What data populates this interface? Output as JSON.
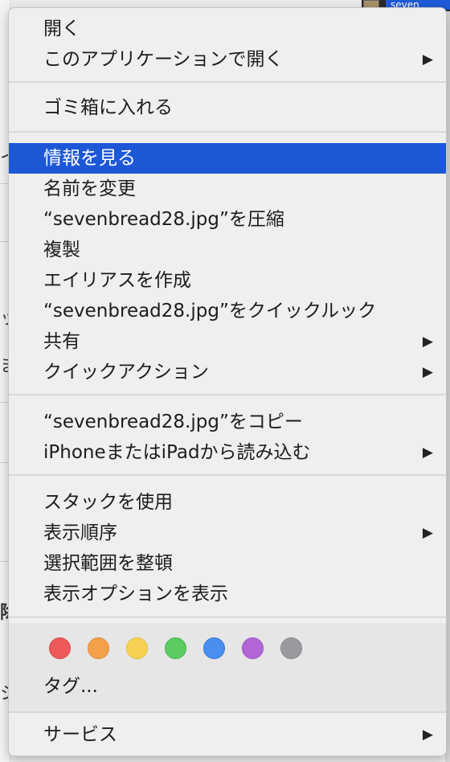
{
  "background": {
    "top_selected_text": "seven",
    "left_fragments": [
      "イ",
      "ッ",
      "ま",
      "除",
      "シ"
    ]
  },
  "menu": {
    "groups": [
      [
        {
          "label": "開く",
          "submenu": false
        },
        {
          "label": "このアプリケーションで開く",
          "submenu": true
        }
      ],
      [
        {
          "label": "ゴミ箱に入れる",
          "submenu": false
        }
      ],
      [
        {
          "label": "情報を見る",
          "submenu": false,
          "highlighted": true
        },
        {
          "label": "名前を変更",
          "submenu": false
        },
        {
          "label": "“sevenbread28.jpg”を圧縮",
          "submenu": false
        },
        {
          "label": "複製",
          "submenu": false
        },
        {
          "label": "エイリアスを作成",
          "submenu": false
        },
        {
          "label": "“sevenbread28.jpg”をクイックルック",
          "submenu": false
        },
        {
          "label": "共有",
          "submenu": true
        },
        {
          "label": "クイックアクション",
          "submenu": true
        }
      ],
      [
        {
          "label": "“sevenbread28.jpg”をコピー",
          "submenu": false
        },
        {
          "label": "iPhoneまたはiPadから読み込む",
          "submenu": true
        }
      ],
      [
        {
          "label": "スタックを使用",
          "submenu": false
        },
        {
          "label": "表示順序",
          "submenu": true
        },
        {
          "label": "選択範囲を整頓",
          "submenu": false
        },
        {
          "label": "表示オプションを表示",
          "submenu": false
        }
      ]
    ],
    "submenu_arrow": "▶",
    "tags": {
      "colors": [
        {
          "name": "red",
          "fill": "#ee5a5a",
          "border": "#d94848"
        },
        {
          "name": "orange",
          "fill": "#f3a04b",
          "border": "#e08b35"
        },
        {
          "name": "yellow",
          "fill": "#f6d154",
          "border": "#e4bc3c"
        },
        {
          "name": "green",
          "fill": "#5ccb62",
          "border": "#46b44d"
        },
        {
          "name": "blue",
          "fill": "#4a8ff0",
          "border": "#3677d9"
        },
        {
          "name": "purple",
          "fill": "#b266d6",
          "border": "#9c52c2"
        },
        {
          "name": "gray",
          "fill": "#9a9a9e",
          "border": "#86868a"
        }
      ],
      "label": "タグ..."
    },
    "services": {
      "label": "サービス",
      "submenu": true
    }
  },
  "theme": {
    "highlight": "#1c57d6",
    "menu_bg": "#efefef"
  }
}
